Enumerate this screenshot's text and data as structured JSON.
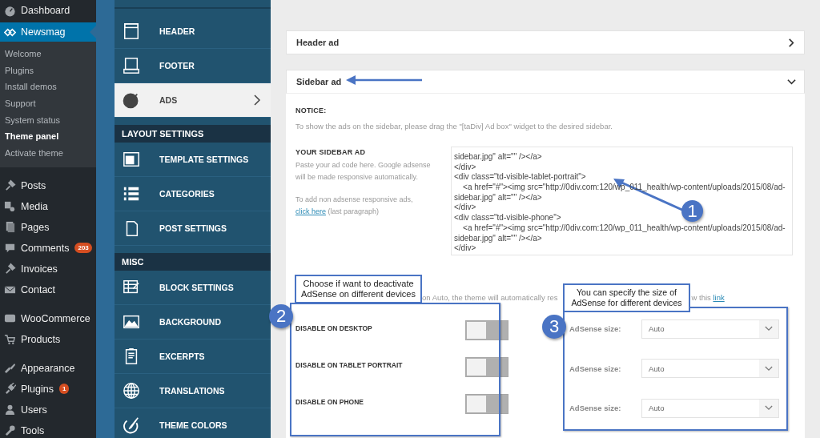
{
  "admin_menu": {
    "groups": [
      {
        "items": [
          {
            "label": "Dashboard",
            "selected": false
          },
          {
            "label": "Newsmag",
            "selected": true,
            "children": [
              {
                "label": "Welcome",
                "selected": false
              },
              {
                "label": "Plugins",
                "selected": false
              },
              {
                "label": "Install demos",
                "selected": false
              },
              {
                "label": "Support",
                "selected": false
              },
              {
                "label": "System status",
                "selected": false
              },
              {
                "label": "Theme panel",
                "selected": true
              },
              {
                "label": "Activate theme",
                "selected": false
              }
            ]
          }
        ]
      },
      {
        "items": [
          {
            "label": "Posts",
            "selected": false
          },
          {
            "label": "Media",
            "selected": false
          },
          {
            "label": "Pages",
            "selected": false
          },
          {
            "label": "Comments",
            "selected": false,
            "badge": "203"
          },
          {
            "label": "Invoices",
            "selected": false
          },
          {
            "label": "Contact",
            "selected": false
          }
        ]
      },
      {
        "items": [
          {
            "label": "WooCommerce",
            "selected": false
          },
          {
            "label": "Products",
            "selected": false
          }
        ]
      },
      {
        "items": [
          {
            "label": "Appearance",
            "selected": false
          },
          {
            "label": "Plugins",
            "selected": false,
            "badge": "1"
          },
          {
            "label": "Users",
            "selected": false
          },
          {
            "label": "Tools",
            "selected": false
          }
        ]
      }
    ]
  },
  "panel_menu": {
    "sections": [
      {
        "items": [
          {
            "label": "HEADER",
            "selected": false
          },
          {
            "label": "FOOTER",
            "selected": false
          },
          {
            "label": "ADS",
            "selected": true
          }
        ]
      },
      {
        "heading": "LAYOUT SETTINGS",
        "items": [
          {
            "label": "TEMPLATE SETTINGS",
            "selected": false
          },
          {
            "label": "CATEGORIES",
            "selected": false
          },
          {
            "label": "POST SETTINGS",
            "selected": false
          }
        ]
      },
      {
        "heading": "MISC",
        "items": [
          {
            "label": "BLOCK SETTINGS",
            "selected": false
          },
          {
            "label": "BACKGROUND",
            "selected": false
          },
          {
            "label": "EXCERPTS",
            "selected": false
          },
          {
            "label": "TRANSLATIONS",
            "selected": false
          },
          {
            "label": "THEME COLORS",
            "selected": false
          }
        ]
      }
    ]
  },
  "accordions": [
    {
      "title": "Header ad",
      "expanded": false
    },
    {
      "title": "Sidebar ad",
      "expanded": true
    }
  ],
  "sidebar_ad": {
    "notice_label": "NOTICE:",
    "notice_text": "To show the ads on the sidebar, please drag the \"[taDiv] Ad box\" widget to the desired sidebar.",
    "ad_label": "YOUR SIDEBAR AD",
    "help": "Paste your ad code here. Google adsense will be made responsive automatically.",
    "help2": "To add non adsense responsive ads,",
    "help_link": "click here",
    "help_suffix": "(last paragraph)",
    "code_lines": [
      "sidebar.jpg\" alt=\"\" /></a>",
      "</div>",
      "<div class=\"td-visible-tablet-portrait\">",
      "    <a href=\"#\"><img src=\"http://0div.com:120/wp_011_health/wp-content/uploads/2015/08/ad-",
      "sidebar.jpg\" alt=\"\" /></a>",
      "</div>",
      "<div class=\"td-visible-phone\">",
      "    <a href=\"#\"><img src=\"http://0div.com:120/wp_011_health/wp-content/uploads/2015/08/ad-",
      "sidebar.jpg\" alt=\"\" /></a>",
      "</div>"
    ],
    "size_notice_start": "on Auto, the theme will automatically res",
    "size_notice_end": "w this",
    "size_notice_link": "link",
    "toggles": [
      {
        "label": "DISABLE ON DESKTOP",
        "on": false
      },
      {
        "label": "DISABLE ON TABLET PORTRAIT",
        "on": false
      },
      {
        "label": "DISABLE ON PHONE",
        "on": false
      }
    ],
    "sizes": [
      {
        "label": "AdSense size:",
        "value": "Auto"
      },
      {
        "label": "AdSense size:",
        "value": "Auto"
      },
      {
        "label": "AdSense size:",
        "value": "Auto"
      }
    ]
  },
  "annotations": [
    {
      "number": "1"
    },
    {
      "number": "2",
      "text": "Choose if want to deactivate AdSense on different devices"
    },
    {
      "number": "3",
      "text": "You can specify the size of AdSense for different devices"
    }
  ]
}
